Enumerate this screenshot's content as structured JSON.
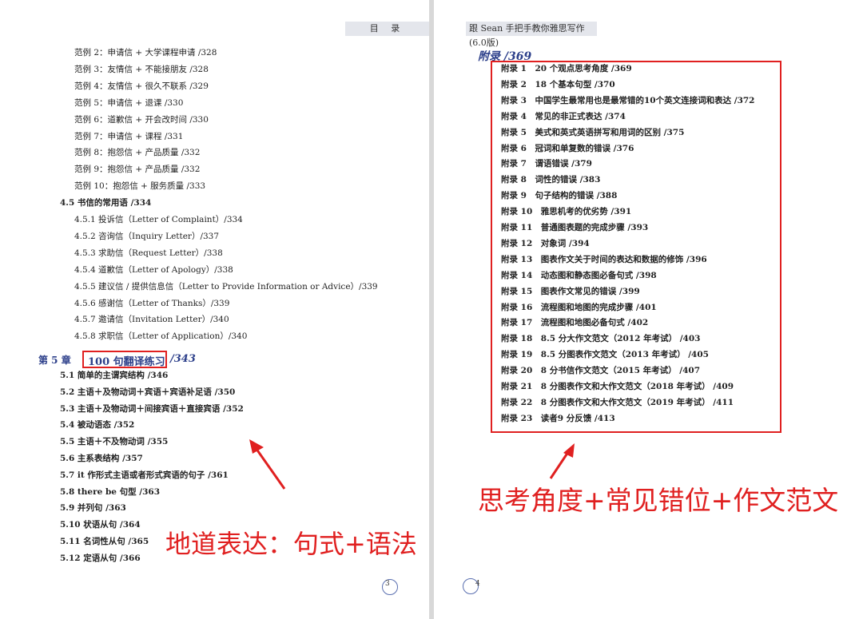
{
  "left_page": {
    "header": "目 录",
    "entries": [
      {
        "text": "范例 2：申请信 + 大学课程申请 /328",
        "indent": 2,
        "bold": false
      },
      {
        "text": "范例 3：友情信 + 不能接朋友 /328",
        "indent": 2,
        "bold": false
      },
      {
        "text": "范例 4：友情信 + 很久不联系 /329",
        "indent": 2,
        "bold": false
      },
      {
        "text": "范例 5：申请信 + 退课 /330",
        "indent": 2,
        "bold": false
      },
      {
        "text": "范例 6：道歉信 + 开会改时间 /330",
        "indent": 2,
        "bold": false
      },
      {
        "text": "范例 7：申请信 + 课程 /331",
        "indent": 2,
        "bold": false
      },
      {
        "text": "范例 8：抱怨信 + 产品质量 /332",
        "indent": 2,
        "bold": false
      },
      {
        "text": "范例 9：抱怨信 + 产品质量 /332",
        "indent": 2,
        "bold": false
      },
      {
        "text": "范例 10：抱怨信 + 服务质量 /333",
        "indent": 2,
        "bold": false
      },
      {
        "text": "4.5 书信的常用语 /334",
        "indent": 1,
        "bold": true
      },
      {
        "text": "4.5.1 投诉信（Letter of Complaint）/334",
        "indent": 2,
        "bold": false
      },
      {
        "text": "4.5.2 咨询信（Inquiry Letter）/337",
        "indent": 2,
        "bold": false
      },
      {
        "text": "4.5.3 求助信（Request Letter）/338",
        "indent": 2,
        "bold": false
      },
      {
        "text": "4.5.4 道歉信（Letter of Apology）/338",
        "indent": 2,
        "bold": false
      },
      {
        "text": "4.5.5 建议信 / 提供信息信（Letter to Provide Information or Advice）/339",
        "indent": 2,
        "bold": false
      },
      {
        "text": "4.5.6 感谢信（Letter of Thanks）/339",
        "indent": 2,
        "bold": false
      },
      {
        "text": "4.5.7 邀请信（Invitation Letter）/340",
        "indent": 2,
        "bold": false
      },
      {
        "text": "4.5.8 求职信（Letter of Application）/340",
        "indent": 2,
        "bold": false
      }
    ],
    "chapter": {
      "label": "第 5 章",
      "title": "100 句翻译练习",
      "page": "/343"
    },
    "chapter_entries": [
      "5.1 简单的主谓宾结构 /346",
      "5.2 主语＋及物动词＋宾语＋宾语补足语 /350",
      "5.3 主语＋及物动词＋间接宾语＋直接宾语 /352",
      "5.4 被动语态 /352",
      "5.5 主语＋不及物动词 /355",
      "5.6 主系表结构 /357",
      "5.7 it 作形式主语或者形式宾语的句子 /361",
      "5.8 there be 句型 /363",
      "5.9 并列句 /363",
      "5.10 状语从句 /364",
      "5.11 名词性从句 /365",
      "5.12 定语从句 /366"
    ],
    "annotation": "地道表达：句式+语法",
    "page_number": "3"
  },
  "right_page": {
    "header": "跟 Sean 手把手教你雅思写作 (6.0版)",
    "appendix_heading": "附录 /369",
    "appendix_entries": [
      "附录 1　20 个观点思考角度 /369",
      "附录 2　18 个基本句型 /370",
      "附录 3　中国学生最常用也是最常错的10个英文连接词和表达 /372",
      "附录 4　常见的非正式表达 /374",
      "附录 5　美式和英式英语拼写和用词的区别 /375",
      "附录 6　冠词和单复数的错误 /376",
      "附录 7　谓语错误 /379",
      "附录 8　词性的错误 /383",
      "附录 9　句子结构的错误 /388",
      "附录 10　雅思机考的优劣势 /391",
      "附录 11　普通图表题的完成步骤 /393",
      "附录 12　对象词 /394",
      "附录 13　图表作文关于时间的表达和数据的修饰 /396",
      "附录 14　动态图和静态图必备句式 /398",
      "附录 15　图表作文常见的错误 /399",
      "附录 16　流程图和地图的完成步骤 /401",
      "附录 17　流程图和地图必备句式 /402",
      "附录 18　8.5 分大作文范文（2012 年考试） /403",
      "附录 19　8.5 分图表作文范文（2013 年考试） /405",
      "附录 20　8 分书信作文范文（2015 年考试） /407",
      "附录 21　8 分图表作文和大作文范文（2018 年考试） /409",
      "附录 22　8 分图表作文和大作文范文（2019 年考试） /411",
      "附录 23　读者9 分反馈 /413"
    ],
    "annotation": "思考角度+常见错位+作文范文",
    "page_number": "4"
  }
}
